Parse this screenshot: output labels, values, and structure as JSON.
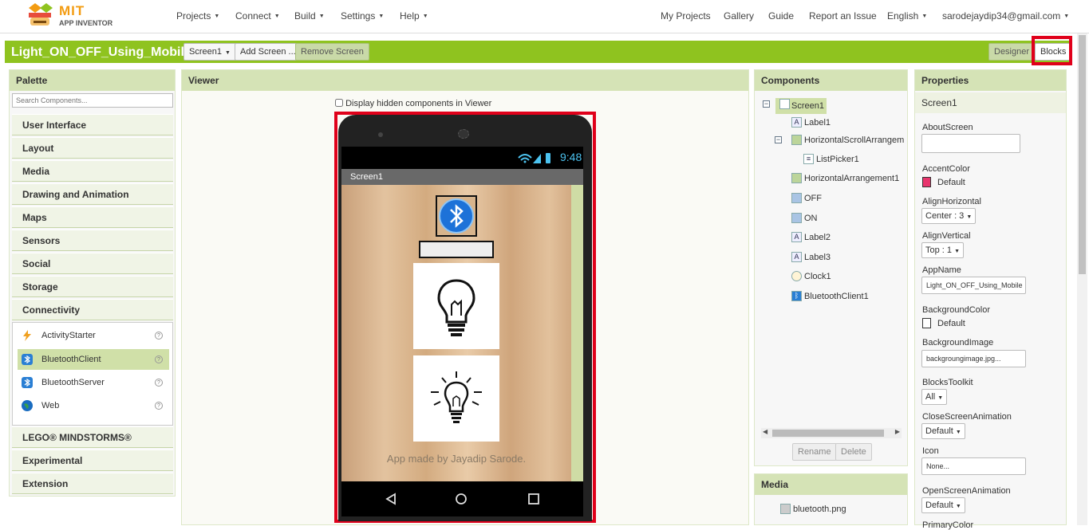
{
  "brand": {
    "name": "MIT",
    "subtitle": "APP INVENTOR"
  },
  "top_menu": [
    "Projects",
    "Connect",
    "Build",
    "Settings",
    "Help"
  ],
  "top_right": {
    "my_projects": "My Projects",
    "gallery": "Gallery",
    "guide": "Guide",
    "report": "Report an Issue",
    "language": "English",
    "user": "sarodejaydip34@gmail.com"
  },
  "toolbar": {
    "project_title": "Light_ON_OFF_Using_Mobile",
    "screen_select": "Screen1",
    "add_screen": "Add Screen ...",
    "remove_screen": "Remove Screen",
    "designer": "Designer",
    "blocks": "Blocks"
  },
  "palette": {
    "title": "Palette",
    "search_placeholder": "Search Components...",
    "categories_top": [
      "User Interface",
      "Layout",
      "Media",
      "Drawing and Animation",
      "Maps",
      "Sensors",
      "Social",
      "Storage",
      "Connectivity"
    ],
    "connectivity_items": [
      "ActivityStarter",
      "BluetoothClient",
      "BluetoothServer",
      "Web"
    ],
    "help_glyph": "?",
    "categories_bottom": [
      "LEGO® MINDSTORMS®",
      "Experimental",
      "Extension"
    ]
  },
  "viewer": {
    "title": "Viewer",
    "hidden_checkbox_label": "Display hidden components in Viewer",
    "status_time": "9:48",
    "screen_title": "Screen1",
    "footer_text": "App made by Jayadip Sarode."
  },
  "components": {
    "title": "Components",
    "tree": [
      "Screen1",
      "Label1",
      "HorizontalScrollArrangem",
      "ListPicker1",
      "HorizontalArrangement1",
      "OFF",
      "ON",
      "Label2",
      "Label3",
      "Clock1",
      "BluetoothClient1"
    ],
    "rename": "Rename",
    "delete": "Delete"
  },
  "media": {
    "title": "Media",
    "items": [
      "bluetooth.png"
    ]
  },
  "properties": {
    "title": "Properties",
    "component": "Screen1",
    "about_label": "AboutScreen",
    "accent_label": "AccentColor",
    "accent_value": "Default",
    "accent_color": "#e8356d",
    "align_h_label": "AlignHorizontal",
    "align_h_value": "Center : 3",
    "align_v_label": "AlignVertical",
    "align_v_value": "Top : 1",
    "appname_label": "AppName",
    "appname_value": "Light_ON_OFF_Using_Mobile",
    "bgcolor_label": "BackgroundColor",
    "bgcolor_value": "Default",
    "bgimage_label": "BackgroundImage",
    "bgimage_value": "backgroungimage.jpg...",
    "toolkit_label": "BlocksToolkit",
    "toolkit_value": "All",
    "close_anim_label": "CloseScreenAnimation",
    "close_anim_value": "Default",
    "icon_label": "Icon",
    "icon_value": "None...",
    "open_anim_label": "OpenScreenAnimation",
    "open_anim_value": "Default",
    "primary_label": "PrimaryColor"
  },
  "colors": {
    "brand_green": "#8fc31f",
    "highlight_red": "#e0001a",
    "panel_header": "#d5e3b6"
  }
}
